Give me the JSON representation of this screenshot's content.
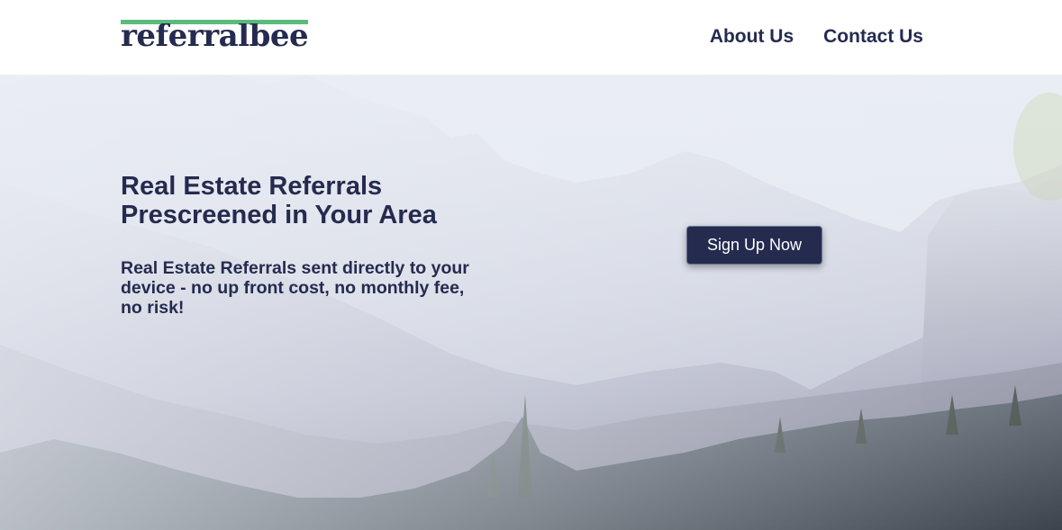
{
  "header": {
    "logo_text": "referralbee",
    "nav": {
      "about_label": "About Us",
      "contact_label": "Contact Us"
    }
  },
  "hero": {
    "title_line1": "Real Estate Referrals",
    "title_line2": "Prescreened in Your Area",
    "subtitle": "Real Estate Referrals sent directly to your device - no up front cost, no monthly fee, no risk!",
    "cta_label": "Sign Up Now"
  },
  "colors": {
    "brand_navy": "#252b4f",
    "logo_accent_green": "#5cba7d",
    "header_background": "#ffffff"
  }
}
